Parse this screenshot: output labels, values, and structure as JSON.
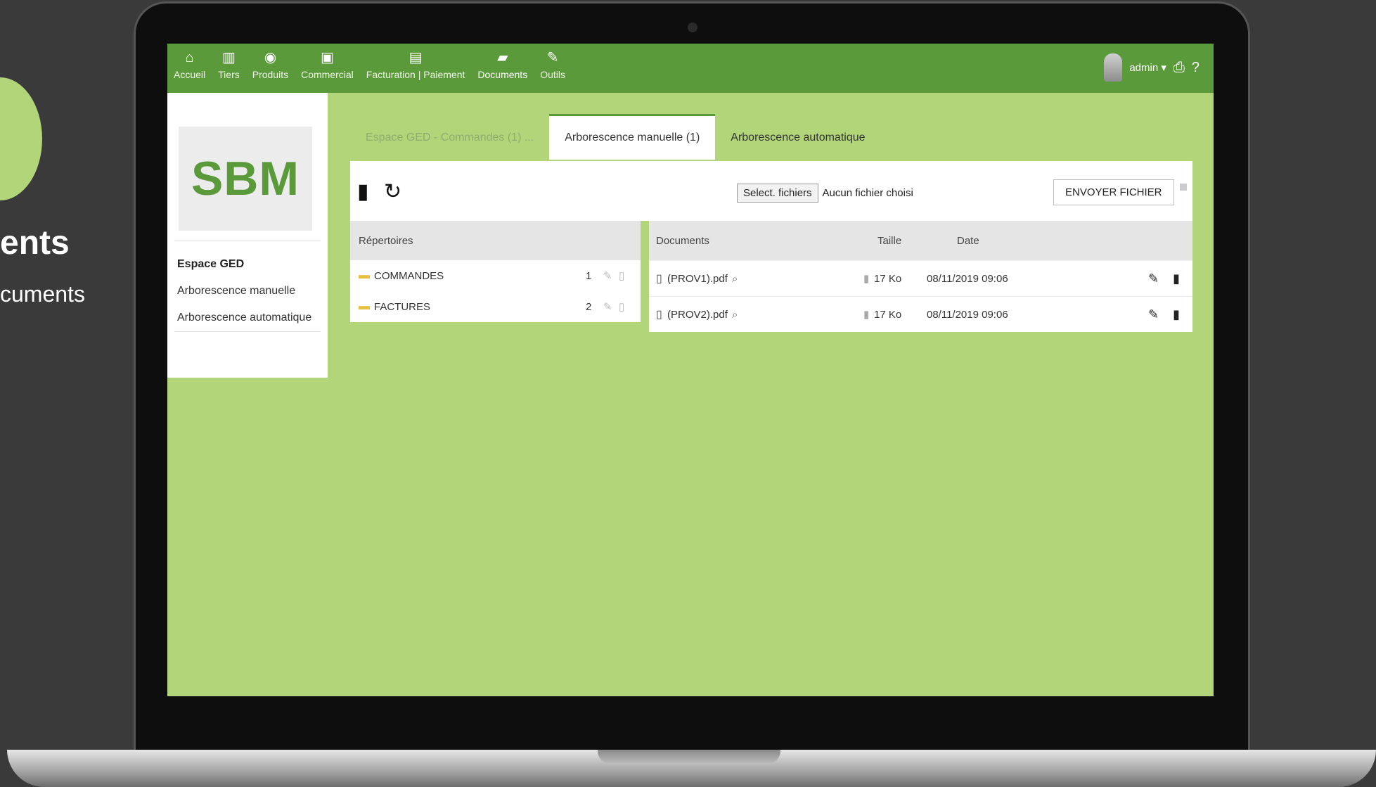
{
  "promo": {
    "title": "ents",
    "subtitle": "cuments"
  },
  "nav": {
    "items": [
      {
        "label": "Accueil",
        "icon": "home-icon",
        "glyph": "⌂"
      },
      {
        "label": "Tiers",
        "icon": "building-icon",
        "glyph": "▥"
      },
      {
        "label": "Produits",
        "icon": "cube-icon",
        "glyph": "◉"
      },
      {
        "label": "Commercial",
        "icon": "briefcase-icon",
        "glyph": "▣"
      },
      {
        "label": "Facturation | Paiement",
        "icon": "money-icon",
        "glyph": "▤"
      },
      {
        "label": "Documents",
        "icon": "folder-open-icon",
        "glyph": "▰"
      },
      {
        "label": "Outils",
        "icon": "wrench-icon",
        "glyph": "✎"
      }
    ],
    "active": "Documents",
    "user": "admin ▾",
    "print_glyph": "⎙",
    "help_glyph": "?"
  },
  "sidebar": {
    "logo": "SBM",
    "title": "Espace GED",
    "links": [
      "Arborescence manuelle",
      "Arborescence automatique"
    ]
  },
  "tabs": [
    {
      "label": "Espace GED - Commandes (1) ...",
      "state": "dim"
    },
    {
      "label": "Arborescence manuelle (1)",
      "state": "active"
    },
    {
      "label": "Arborescence automatique",
      "state": "normal"
    }
  ],
  "toolbar": {
    "new_folder_glyph": "▮",
    "refresh_glyph": "↻",
    "select_files_label": "Select. fichiers",
    "no_file_label": "Aucun fichier choisi",
    "send_label": "ENVOYER FICHIER"
  },
  "directories": {
    "header": "Répertoires",
    "rows": [
      {
        "name": "COMMANDES",
        "count": "1"
      },
      {
        "name": "FACTURES",
        "count": "2"
      }
    ]
  },
  "documents": {
    "headers": {
      "name": "Documents",
      "size": "Taille",
      "date": "Date"
    },
    "rows": [
      {
        "name": "(PROV1).pdf",
        "size": "17 Ko",
        "date": "08/11/2019 09:06"
      },
      {
        "name": "(PROV2).pdf",
        "size": "17 Ko",
        "date": "08/11/2019 09:06"
      }
    ]
  }
}
